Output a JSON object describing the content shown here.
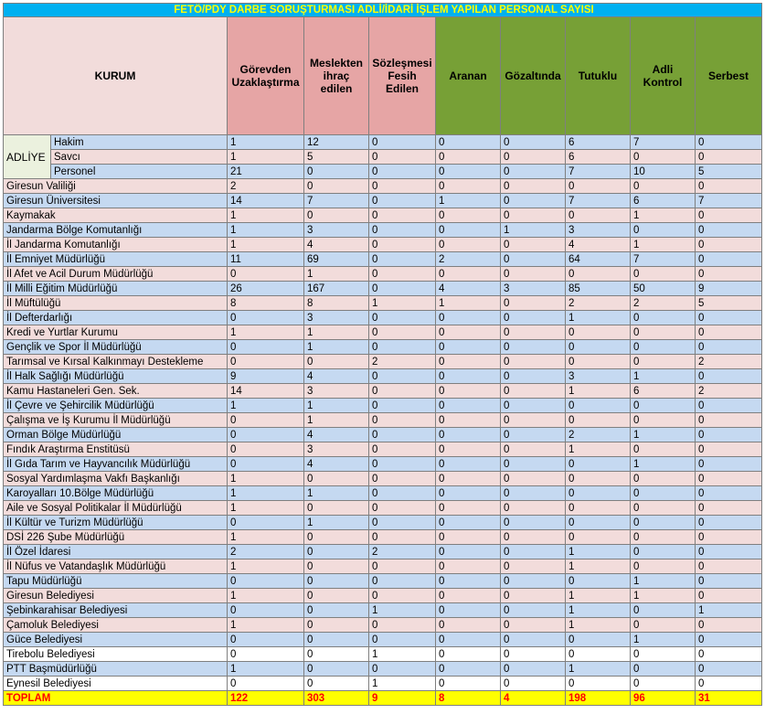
{
  "title": "FETÖ/PDY DARBE SORUŞTURMASI ADLİ/İDARİ İŞLEM YAPILAN PERSONAL SAYISI",
  "headers": [
    "KURUM",
    "Görevden Uzaklaştırma",
    "Meslekten ihraç edilen",
    "Sözleşmesi Fesih Edilen",
    "Aranan",
    "Gözaltında",
    "Tutuklu",
    "Adli Kontrol",
    "Serbest"
  ],
  "adliye_label": "ADLİYE",
  "adliye_rows": [
    {
      "name": "Hakim",
      "values": [
        "1",
        "12",
        "0",
        "0",
        "0",
        "6",
        "7",
        "0"
      ]
    },
    {
      "name": "Savcı",
      "values": [
        "1",
        "5",
        "0",
        "0",
        "0",
        "6",
        "0",
        "0"
      ]
    },
    {
      "name": "Personel",
      "values": [
        "21",
        "0",
        "0",
        "0",
        "0",
        "7",
        "10",
        "5"
      ]
    }
  ],
  "rows": [
    {
      "name": "Giresun Valiliği",
      "values": [
        "2",
        "0",
        "0",
        "0",
        "0",
        "0",
        "0",
        "0"
      ]
    },
    {
      "name": "Giresun Üniversitesi",
      "values": [
        "14",
        "7",
        "0",
        "1",
        "0",
        "7",
        "6",
        "7"
      ]
    },
    {
      "name": "Kaymakak",
      "values": [
        "1",
        "0",
        "0",
        "0",
        "0",
        "0",
        "1",
        "0"
      ]
    },
    {
      "name": "Jandarma Bölge Komutanlığı",
      "values": [
        "1",
        "3",
        "0",
        "0",
        "1",
        "3",
        "0",
        "0"
      ]
    },
    {
      "name": "İl Jandarma Komutanlığı",
      "values": [
        "1",
        "4",
        "0",
        "0",
        "0",
        "4",
        "1",
        "0"
      ]
    },
    {
      "name": "İl Emniyet Müdürlüğü",
      "values": [
        "11",
        "69",
        "0",
        "2",
        "0",
        "64",
        "7",
        "0"
      ]
    },
    {
      "name": "İl Afet ve Acil Durum Müdürlüğü",
      "values": [
        "0",
        "1",
        "0",
        "0",
        "0",
        "0",
        "0",
        "0"
      ]
    },
    {
      "name": "İl Milli Eğitim Müdürlüğü",
      "values": [
        "26",
        "167",
        "0",
        "4",
        "3",
        "85",
        "50",
        "9"
      ]
    },
    {
      "name": "İl Müftülüğü",
      "values": [
        "8",
        "8",
        "1",
        "1",
        "0",
        "2",
        "2",
        "5"
      ]
    },
    {
      "name": "İl Defterdarlığı",
      "values": [
        "0",
        "3",
        "0",
        "0",
        "0",
        "1",
        "0",
        "0"
      ]
    },
    {
      "name": "Kredi ve Yurtlar Kurumu",
      "values": [
        "1",
        "1",
        "0",
        "0",
        "0",
        "0",
        "0",
        "0"
      ]
    },
    {
      "name": "Gençlik ve Spor İl Müdürlüğü",
      "values": [
        "0",
        "1",
        "0",
        "0",
        "0",
        "0",
        "0",
        "0"
      ]
    },
    {
      "name": "Tarımsal ve Kırsal Kalkınmayı Destekleme",
      "values": [
        "0",
        "0",
        "2",
        "0",
        "0",
        "0",
        "0",
        "2"
      ]
    },
    {
      "name": "İl Halk Sağlığı Müdürlüğü",
      "values": [
        "9",
        "4",
        "0",
        "0",
        "0",
        "3",
        "1",
        "0"
      ]
    },
    {
      "name": "Kamu Hastaneleri Gen. Sek.",
      "values": [
        "14",
        "3",
        "0",
        "0",
        "0",
        "1",
        "6",
        "2"
      ]
    },
    {
      "name": "İl Çevre ve Şehircilik Müdürlüğü",
      "values": [
        "1",
        "1",
        "0",
        "0",
        "0",
        "0",
        "0",
        "0"
      ]
    },
    {
      "name": "Çalışma ve İş Kurumu İl Müdürlüğü",
      "values": [
        "0",
        "1",
        "0",
        "0",
        "0",
        "0",
        "0",
        "0"
      ]
    },
    {
      "name": "Orman Bölge Müdürlüğü",
      "values": [
        "0",
        "4",
        "0",
        "0",
        "0",
        "2",
        "1",
        "0"
      ]
    },
    {
      "name": "Fındık Araştırma Enstitüsü",
      "values": [
        "0",
        "3",
        "0",
        "0",
        "0",
        "1",
        "0",
        "0"
      ]
    },
    {
      "name": "İl Gıda Tarım ve Hayvancılık Müdürlüğü",
      "values": [
        "0",
        "4",
        "0",
        "0",
        "0",
        "0",
        "1",
        "0"
      ]
    },
    {
      "name": "Sosyal Yardımlaşma Vakfı Başkanlığı",
      "values": [
        "1",
        "0",
        "0",
        "0",
        "0",
        "0",
        "0",
        "0"
      ]
    },
    {
      "name": "Karoyalları 10.Bölge Müdürlüğü",
      "values": [
        "1",
        "1",
        "0",
        "0",
        "0",
        "0",
        "0",
        "0"
      ]
    },
    {
      "name": "Aile ve Sosyal Politikalar İl Müdürlüğü",
      "values": [
        "1",
        "0",
        "0",
        "0",
        "0",
        "0",
        "0",
        "0"
      ]
    },
    {
      "name": "İl Kültür ve Turizm Müdürlüğü",
      "values": [
        "0",
        "1",
        "0",
        "0",
        "0",
        "0",
        "0",
        "0"
      ]
    },
    {
      "name": "DSİ 226 Şube Müdürlüğü",
      "values": [
        "1",
        "0",
        "0",
        "0",
        "0",
        "0",
        "0",
        "0"
      ]
    },
    {
      "name": "İl Özel İdaresi",
      "values": [
        "2",
        "0",
        "2",
        "0",
        "0",
        "1",
        "0",
        "0"
      ]
    },
    {
      "name": "İl Nüfus ve Vatandaşlık Müdürlüğü",
      "values": [
        "1",
        "0",
        "0",
        "0",
        "0",
        "1",
        "0",
        "0"
      ]
    },
    {
      "name": "Tapu Müdürlüğü",
      "values": [
        "0",
        "0",
        "0",
        "0",
        "0",
        "0",
        "1",
        "0"
      ]
    },
    {
      "name": "Giresun Belediyesi",
      "values": [
        "1",
        "0",
        "0",
        "0",
        "0",
        "1",
        "1",
        "0"
      ]
    },
    {
      "name": "Şebinkarahisar Belediyesi",
      "values": [
        "0",
        "0",
        "1",
        "0",
        "0",
        "1",
        "0",
        "1"
      ]
    },
    {
      "name": "Çamoluk Belediyesi",
      "values": [
        "1",
        "0",
        "0",
        "0",
        "0",
        "1",
        "0",
        "0"
      ]
    },
    {
      "name": "Güce Belediyesi",
      "values": [
        "0",
        "0",
        "0",
        "0",
        "0",
        "0",
        "1",
        "0"
      ]
    },
    {
      "name": "Tirebolu Belediyesi",
      "values": [
        "0",
        "0",
        "1",
        "0",
        "0",
        "0",
        "0",
        "0"
      ]
    },
    {
      "name": "PTT Başmüdürlüğü",
      "values": [
        "1",
        "0",
        "0",
        "0",
        "0",
        "1",
        "0",
        "0"
      ]
    },
    {
      "name": "Eynesil Belediyesi",
      "values": [
        "0",
        "0",
        "1",
        "0",
        "0",
        "0",
        "0",
        "0"
      ]
    }
  ],
  "total": {
    "name": "TOPLAM",
    "values": [
      "122",
      "303",
      "9",
      "8",
      "4",
      "198",
      "96",
      "31"
    ]
  },
  "colors": {
    "title_bg": "#00b0f0",
    "title_text": "#ffff00",
    "row_blue": "#c5d9f1",
    "row_pink": "#f2dcdb",
    "header_pink": "#e6a5a5",
    "header_green": "#77a036",
    "total_bg": "#ffff00",
    "total_text": "#ff0000"
  }
}
